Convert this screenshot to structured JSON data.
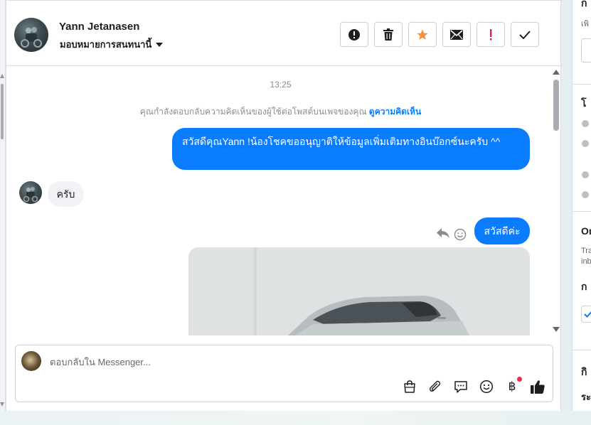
{
  "header": {
    "contact_name": "Yann Jetanasen",
    "assign_label": "มอบหมายการสนทนานี้",
    "actions": [
      {
        "name": "spam-button",
        "icon": "alert-circle-icon"
      },
      {
        "name": "delete-button",
        "icon": "trash-icon"
      },
      {
        "name": "star-button",
        "icon": "star-icon",
        "color": "#f7923a"
      },
      {
        "name": "mark-unread-button",
        "icon": "envelope-icon"
      },
      {
        "name": "important-button",
        "icon": "exclamation-icon",
        "color": "#e41e3f"
      },
      {
        "name": "done-button",
        "icon": "check-icon"
      }
    ]
  },
  "thread": {
    "timestamp": "13:25",
    "notice_text": "คุณกำลังตอบกลับความคิดเห็นของผู้ใช้ต่อโพสต์บนเพจของคุณ",
    "notice_link": "ดูความคิดเห็น",
    "messages": [
      {
        "direction": "outgoing",
        "text": "สวัสดีคุณYann !น้องโชคขออนุญาติให้ข้อมูลเพิ่มเติมทางอินบ๊อกซ์นะครับ ^^"
      },
      {
        "direction": "incoming",
        "text": "ครับ"
      },
      {
        "direction": "outgoing",
        "text": "สวัสดีค่ะ"
      },
      {
        "direction": "outgoing",
        "type": "image",
        "icon": "car-photo"
      }
    ]
  },
  "composer": {
    "placeholder": "ตอบกลับใน Messenger...",
    "value": "",
    "tools": [
      "shopping-bag-icon",
      "paperclip-icon",
      "saved-replies-icon",
      "emoji-icon",
      "baht-payment-icon",
      "like-icon"
    ]
  },
  "right_panel": {
    "heading_1": "โ",
    "heading_2": "Or",
    "small_text_1": "Tra",
    "small_text_2": "inb",
    "heading_3": "ก",
    "heading_4": "กิ",
    "heading_5": "ระ",
    "top_text": "เพิ"
  },
  "colors": {
    "accent": "#0a7cff",
    "incoming_bubble": "#f0f2f5"
  }
}
